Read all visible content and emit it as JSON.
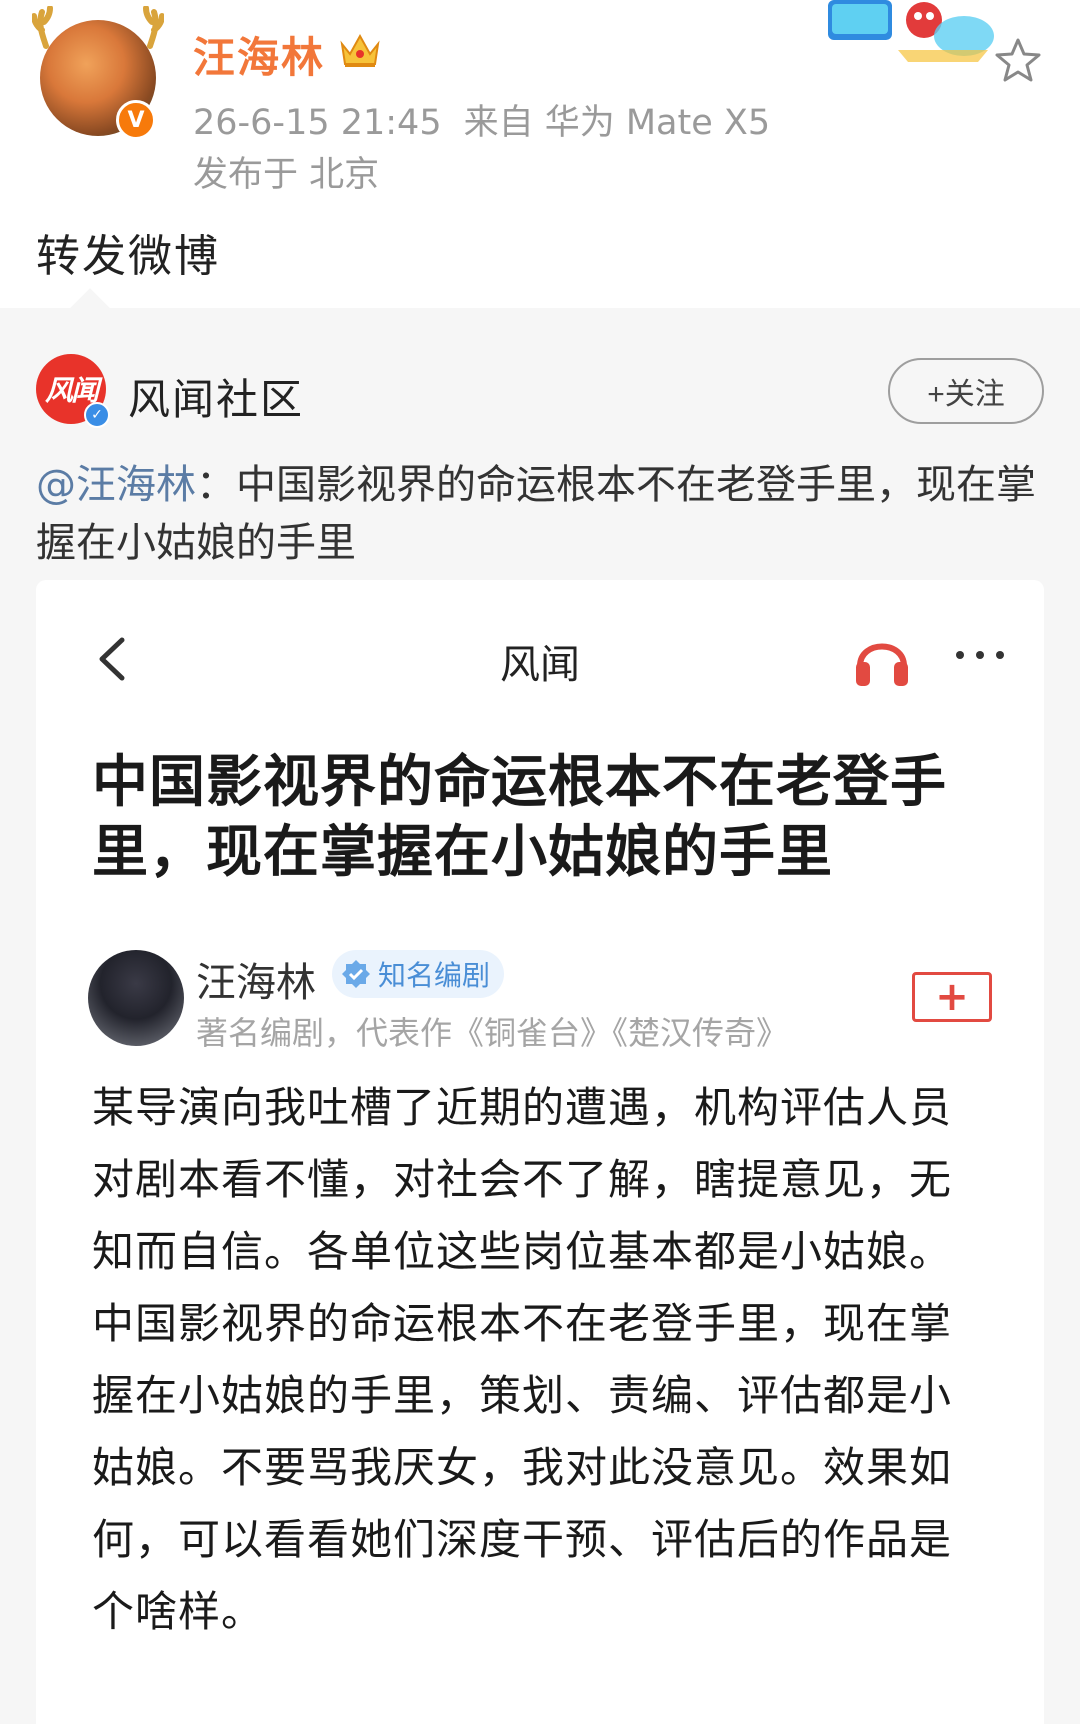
{
  "post": {
    "author": "汪海林",
    "timestamp": "26-6-15 21:45",
    "source": "来自 华为 Mate X5",
    "location": "发布于 北京",
    "content": "转发微博",
    "verified_badge": "V",
    "icons": [
      "crown-icon",
      "star-icon",
      "avatar-image",
      "sticker-image"
    ]
  },
  "repost": {
    "author": "风闻社区",
    "avatar_text": "风闻",
    "follow_label": "+关注",
    "mention": "@汪海林",
    "text": "：中国影视界的命运根本不在老登手里，现在掌握在小姑娘的手里"
  },
  "article": {
    "header_title": "风闻",
    "title": "中国影视界的命运根本不在老登手里，现在掌握在小姑娘的手里",
    "author_name": "汪海林",
    "author_badge": "知名编剧",
    "author_desc": "著名编剧，代表作《铜雀台》《楚汉传奇》",
    "author_follow": "+",
    "body": "某导演向我吐槽了近期的遭遇，机构评估人员对剧本看不懂，对社会不了解，瞎提意见，无知而自信。各单位这些岗位基本都是小姑娘。中国影视界的命运根本不在老登手里，现在掌握在小姑娘的手里，策划、责编、评估都是小姑娘。不要骂我厌女，我对此没意见。效果如何，可以看看她们深度干预、评估后的作品是个啥样。"
  },
  "colors": {
    "username": "#f2773a",
    "mention": "#5b7ca5",
    "brand_red": "#e8332a",
    "badge_blue": "#4a8ed6",
    "meta_gray": "#9a9a9a"
  }
}
